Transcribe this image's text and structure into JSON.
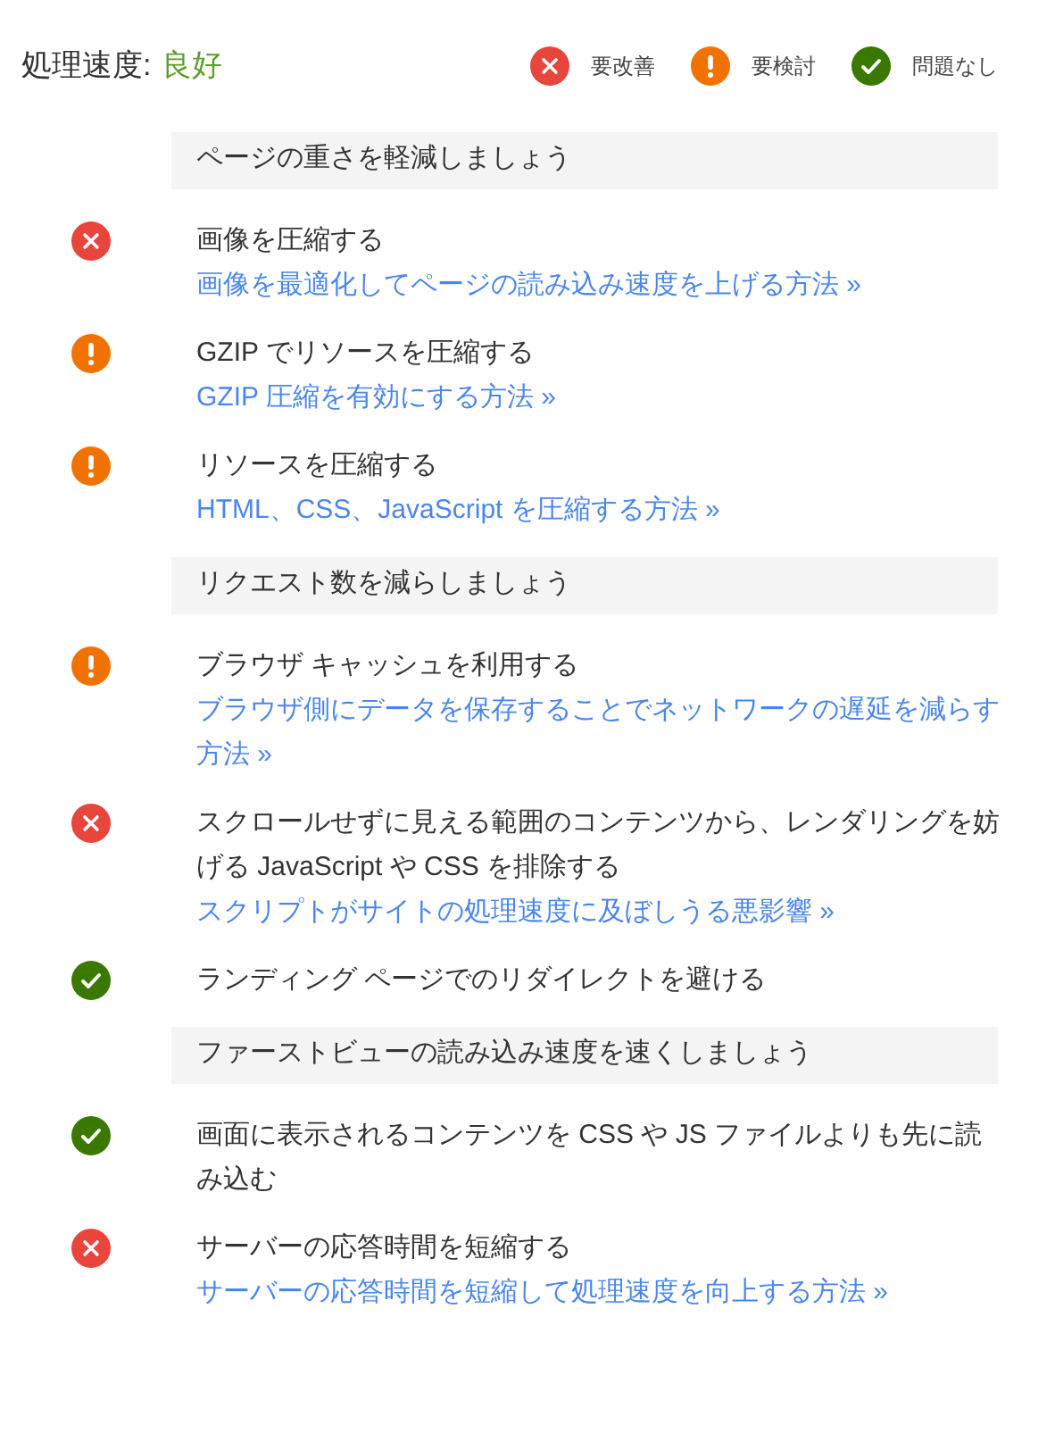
{
  "header": {
    "label": "処理速度:",
    "value": "良好"
  },
  "legend": [
    {
      "kind": "fail",
      "label": "要改善"
    },
    {
      "kind": "warn",
      "label": "要検討"
    },
    {
      "kind": "pass",
      "label": "問題なし"
    }
  ],
  "sections": [
    {
      "title": "ページの重さを軽減しましょう",
      "items": [
        {
          "kind": "fail",
          "title": "画像を圧縮する",
          "link": "画像を最適化してページの読み込み速度を上げる方法 »"
        },
        {
          "kind": "warn",
          "title": "GZIP でリソースを圧縮する",
          "link": "GZIP 圧縮を有効にする方法 »"
        },
        {
          "kind": "warn",
          "title": "リソースを圧縮する",
          "link": "HTML、CSS、JavaScript を圧縮する方法 »"
        }
      ]
    },
    {
      "title": "リクエスト数を減らしましょう",
      "items": [
        {
          "kind": "warn",
          "title": "ブラウザ キャッシュを利用する",
          "link": "ブラウザ側にデータを保存することでネットワークの遅延を減らす方法 »"
        },
        {
          "kind": "fail",
          "title": "スクロールせずに見える範囲のコンテンツから、レンダリングを妨げる JavaScript や CSS を排除する",
          "link": "スクリプトがサイトの処理速度に及ぼしうる悪影響 »"
        },
        {
          "kind": "pass",
          "title": "ランディング ページでのリダイレクトを避ける"
        }
      ]
    },
    {
      "title": "ファーストビューの読み込み速度を速くしましょう",
      "items": [
        {
          "kind": "pass",
          "title": "画面に表示されるコンテンツを CSS や JS ファイルよりも先に読み込む"
        },
        {
          "kind": "fail",
          "title": "サーバーの応答時間を短縮する",
          "link": "サーバーの応答時間を短縮して処理速度を向上する方法 »"
        }
      ]
    }
  ]
}
